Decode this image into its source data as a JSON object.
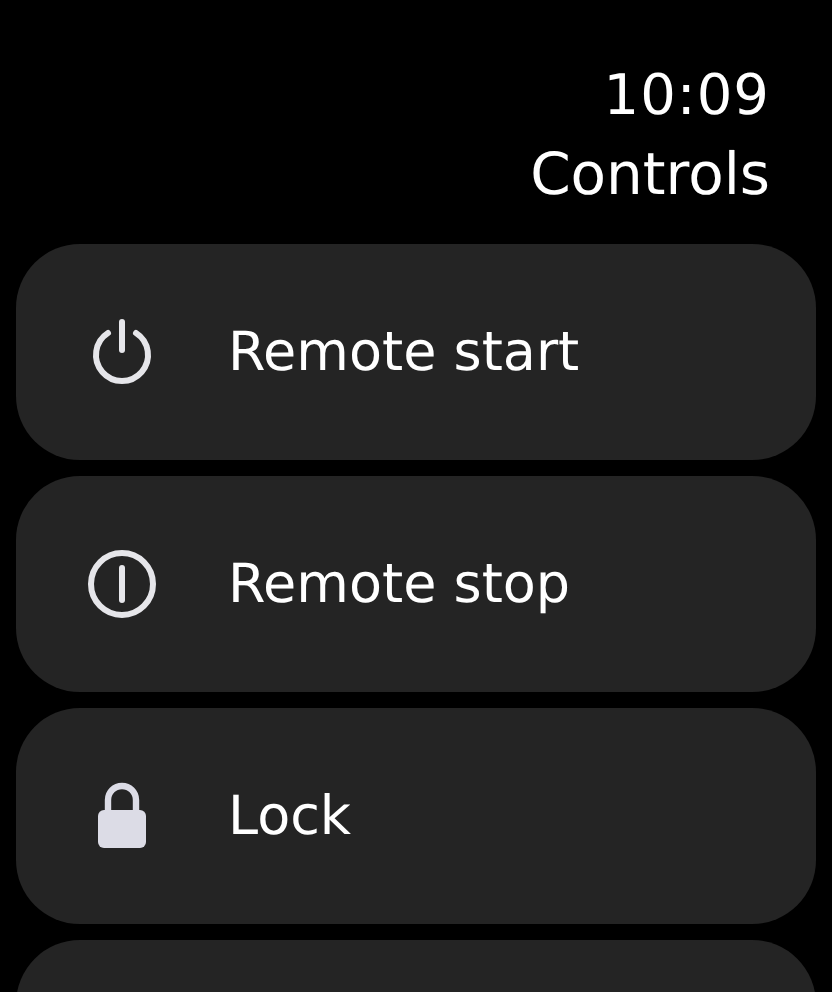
{
  "status_bar": {
    "time": "10:09"
  },
  "title": "Controls",
  "controls": [
    {
      "kind": "power",
      "label": "Remote start"
    },
    {
      "kind": "stop",
      "label": "Remote stop"
    },
    {
      "kind": "lock",
      "label": "Lock"
    }
  ]
}
